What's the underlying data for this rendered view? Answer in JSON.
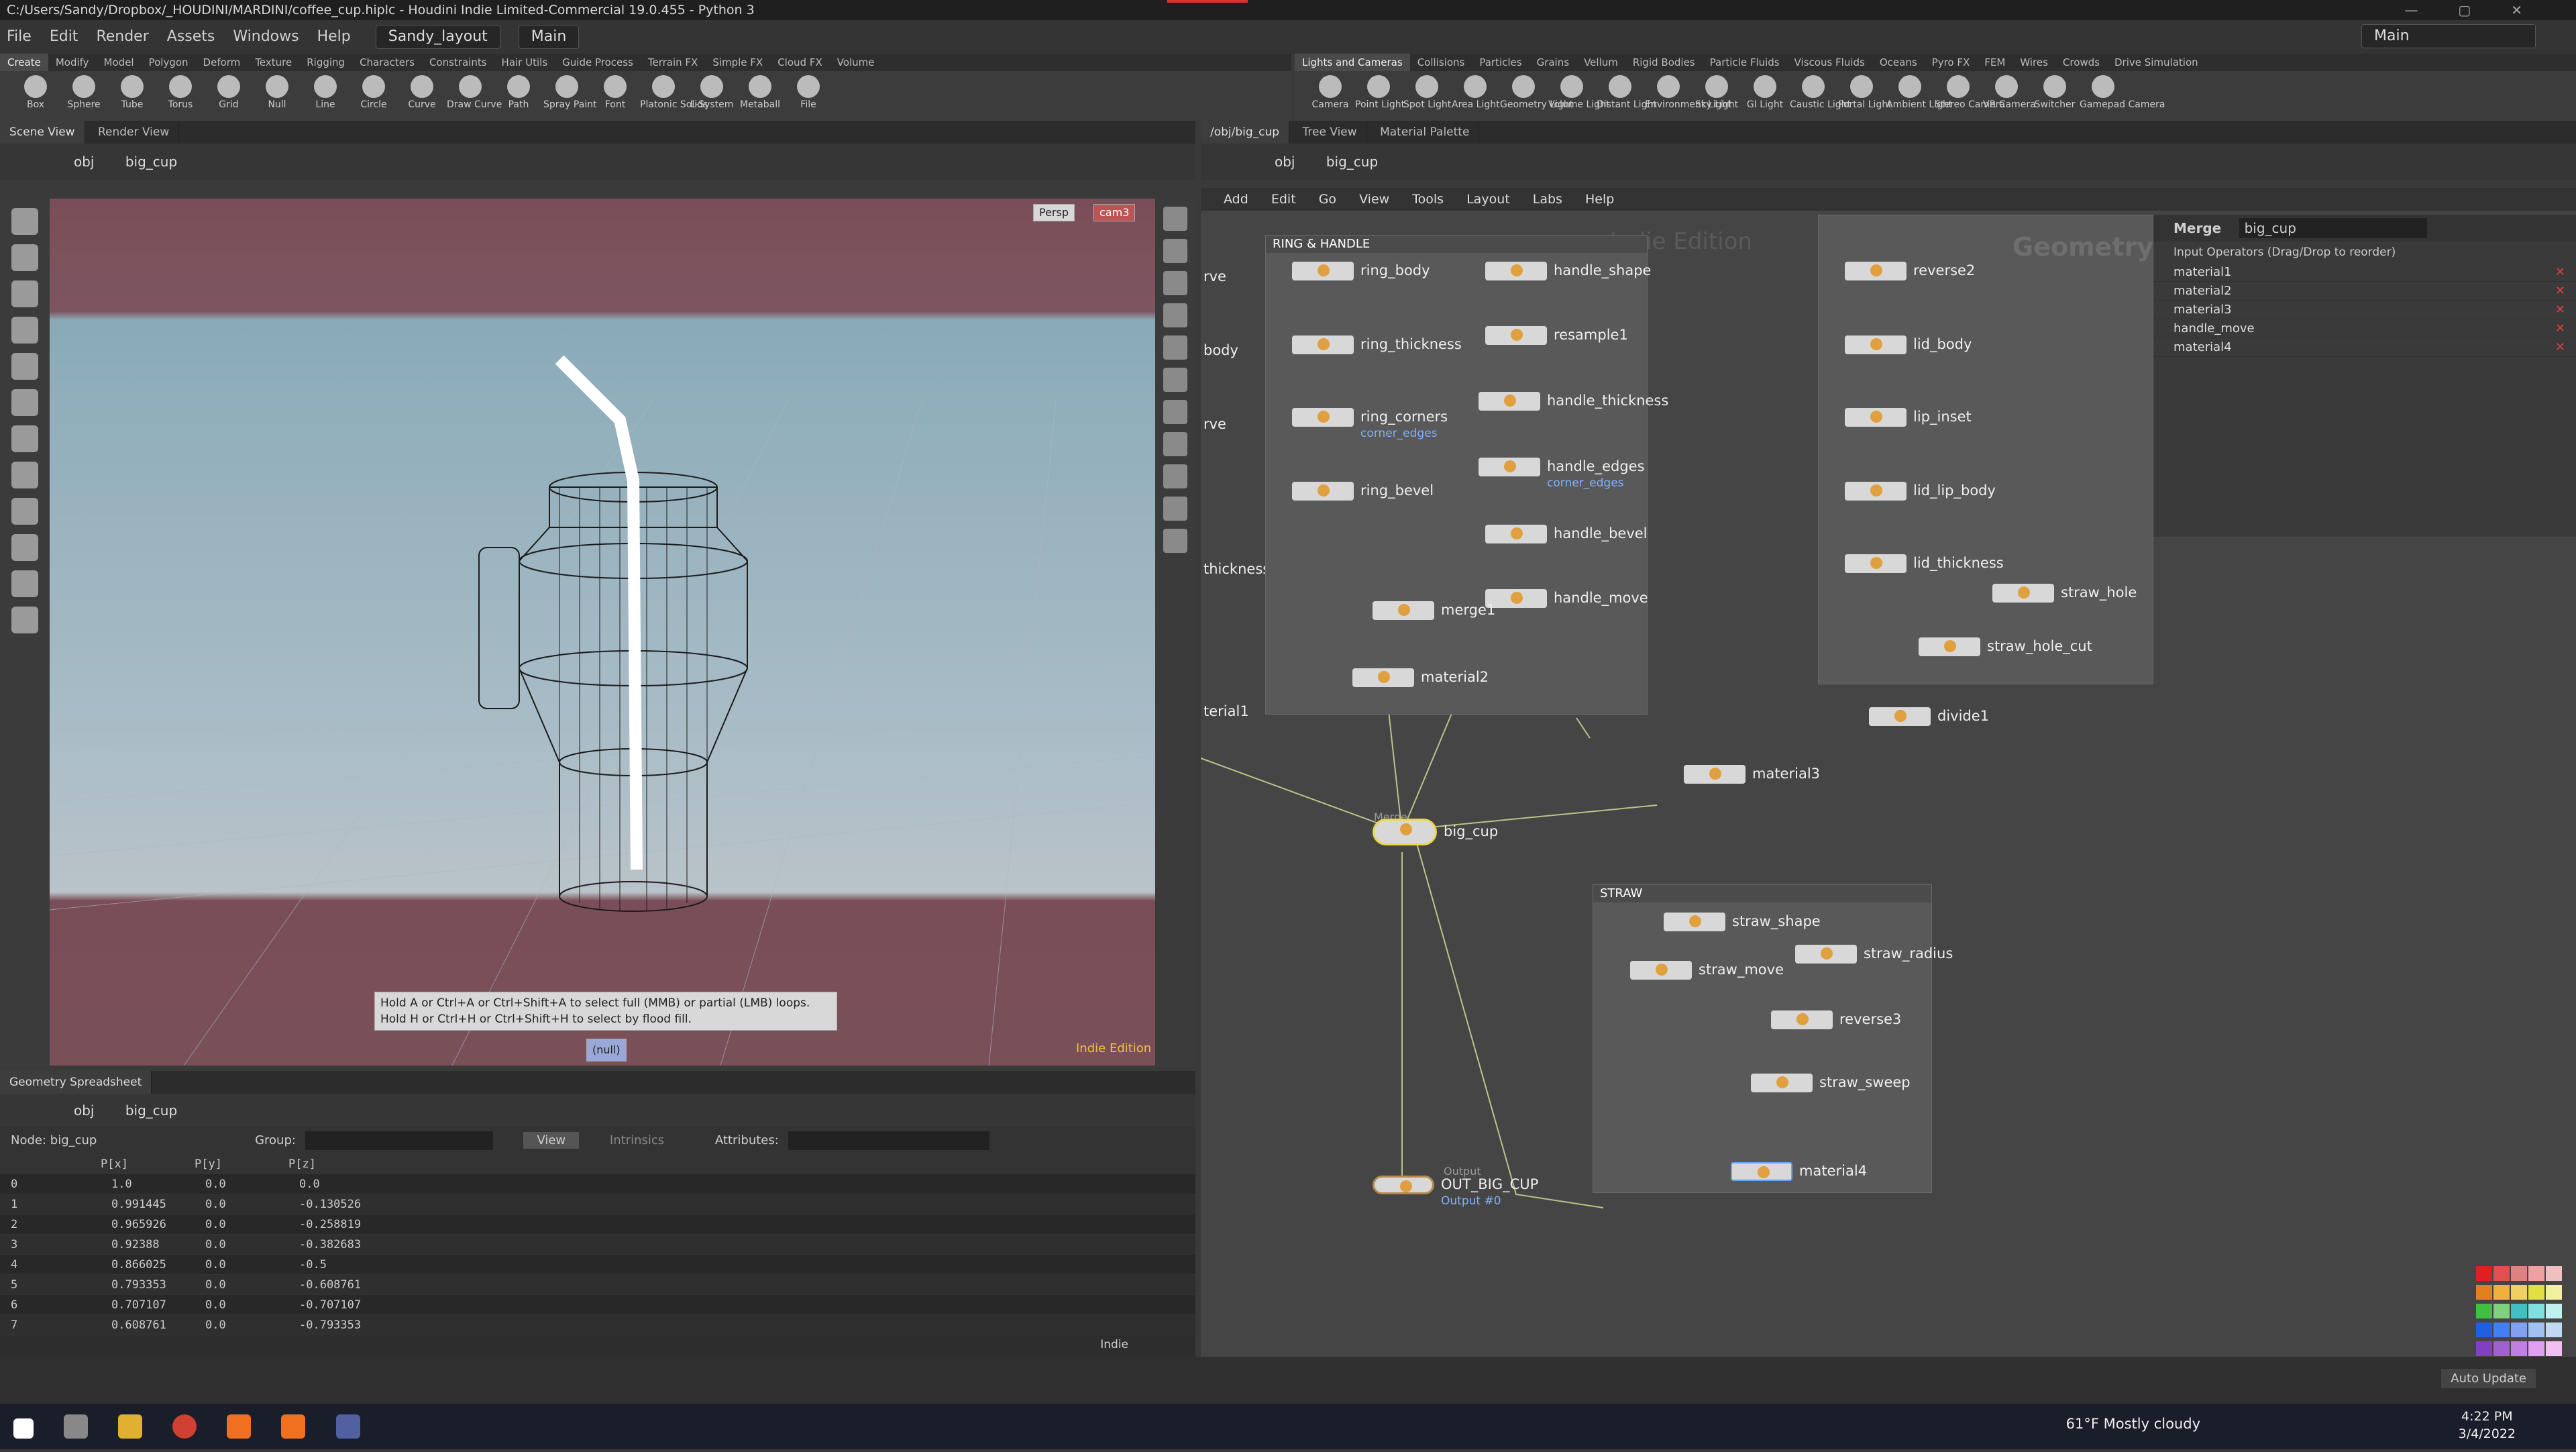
{
  "window": {
    "title": "C:/Users/Sandy/Dropbox/_HOUDINI/MARDINI/coffee_cup.hiplc - Houdini Indie Limited-Commercial 19.0.455 - Python 3"
  },
  "menu": {
    "items": [
      "File",
      "Edit",
      "Render",
      "Assets",
      "Windows",
      "Help"
    ],
    "layout": "Sandy_layout",
    "desktop": "Main",
    "right_desktop": "Main"
  },
  "shelf_left": {
    "tabs": [
      "Create",
      "Modify",
      "Model",
      "Polygon",
      "Deform",
      "Texture",
      "Rigging",
      "Characters",
      "Constraints",
      "Hair Utils",
      "Guide Process",
      "Terrain FX",
      "Simple FX",
      "Cloud FX",
      "Volume"
    ],
    "tools": [
      "Box",
      "Sphere",
      "Tube",
      "Torus",
      "Grid",
      "Null",
      "Line",
      "Circle",
      "Curve",
      "Draw Curve",
      "Path",
      "Spray Paint",
      "Font",
      "Platonic Solids",
      "L-System",
      "Metaball",
      "File"
    ]
  },
  "shelf_right": {
    "tabs": [
      "Lights and Cameras",
      "Collisions",
      "Particles",
      "Grains",
      "Vellum",
      "Rigid Bodies",
      "Particle Fluids",
      "Viscous Fluids",
      "Oceans",
      "Pyro FX",
      "FEM",
      "Wires",
      "Crowds",
      "Drive Simulation"
    ],
    "tools": [
      "Camera",
      "Point Light",
      "Spot Light",
      "Area Light",
      "Geometry Light",
      "Volume Light",
      "Distant Light",
      "Environment Light",
      "Sky Light",
      "GI Light",
      "Caustic Light",
      "Portal Light",
      "Ambient Light",
      "Stereo Camera",
      "VR Camera",
      "Switcher",
      "Gamepad Camera"
    ]
  },
  "scene_view": {
    "tabs": [
      "Scene View",
      "Render View"
    ],
    "path": [
      "obj",
      "big_cup"
    ],
    "persp_label": "Persp",
    "cam_label": "cam3",
    "hint_line1": "Hold A or Ctrl+A or Ctrl+Shift+A to select full (MMB) or partial (LMB) loops.",
    "hint_line2": "Hold H or Ctrl+H or Ctrl+Shift+H to select by flood fill.",
    "null_label": "(null)",
    "edition": "Indie Edition"
  },
  "spreadsheet": {
    "tab": "Geometry Spreadsheet",
    "path": [
      "obj",
      "big_cup"
    ],
    "node_label": "Node: big_cup",
    "group_label": "Group:",
    "view_label": "View",
    "intrinsics_label": "Intrinsics",
    "attributes_label": "Attributes:",
    "columns": [
      "",
      "P[x]",
      "P[y]",
      "P[z]"
    ],
    "rows": [
      [
        "0",
        "1.0",
        "0.0",
        "0.0"
      ],
      [
        "1",
        "0.991445",
        "0.0",
        "-0.130526"
      ],
      [
        "2",
        "0.965926",
        "0.0",
        "-0.258819"
      ],
      [
        "3",
        "0.92388",
        "0.0",
        "-0.382683"
      ],
      [
        "4",
        "0.866025",
        "0.0",
        "-0.5"
      ],
      [
        "5",
        "0.793353",
        "0.0",
        "-0.608761"
      ],
      [
        "6",
        "0.707107",
        "0.0",
        "-0.707107"
      ],
      [
        "7",
        "0.608761",
        "0.0",
        "-0.793353"
      ]
    ],
    "footer": "Indie"
  },
  "network": {
    "tabs": [
      "/obj/big_cup",
      "Tree View",
      "Material Palette"
    ],
    "path": [
      "obj",
      "big_cup"
    ],
    "menu": [
      "Add",
      "Edit",
      "Go",
      "View",
      "Tools",
      "Layout",
      "Labs",
      "Help"
    ],
    "watermark_edition": "Indie Edition",
    "watermark_context": "Geometry",
    "box_ring": "RING & HANDLE",
    "box_straw": "STRAW",
    "left_cut": [
      "rve",
      "body",
      "rve",
      "thickness",
      "terial1"
    ],
    "ring_nodes": [
      "ring_body",
      "ring_thickness",
      "ring_corners",
      "ring_bevel",
      "handle_shape",
      "resample1",
      "handle_thickness",
      "handle_edges",
      "handle_bevel",
      "handle_move",
      "merge1",
      "material2"
    ],
    "ring_subs": [
      "corner_edges",
      "corner_edges"
    ],
    "lid_nodes": [
      "reverse2",
      "lid_body",
      "lip_inset",
      "lid_lip_body",
      "lid_thickness",
      "straw_hole",
      "straw_hole_cut",
      "divide1",
      "material3"
    ],
    "straw_nodes": [
      "straw_shape",
      "straw_radius",
      "straw_move",
      "reverse3",
      "straw_sweep",
      "material4"
    ],
    "merge_node": "big_cup",
    "merge_type": "Merge",
    "output_node": "OUT_BIG_CUP",
    "output_type": "Output",
    "output_sub": "Output #0"
  },
  "params": {
    "type": "Merge",
    "name": "big_cup",
    "section": "Input Operators (Drag/Drop to reorder)",
    "inputs": [
      "material1",
      "material2",
      "material3",
      "handle_move",
      "material4"
    ]
  },
  "status": {
    "auto_update": "Auto Update"
  },
  "taskbar": {
    "weather": "61°F  Mostly cloudy",
    "time": "4:22 PM",
    "date": "3/4/2022"
  }
}
